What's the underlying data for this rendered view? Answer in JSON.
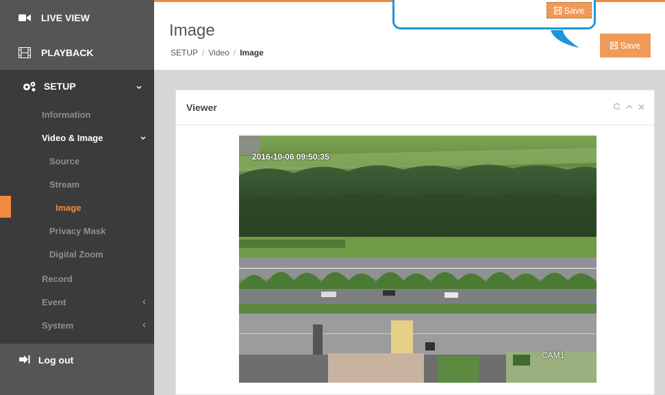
{
  "sidebar": {
    "live_view": "LIVE VIEW",
    "playback": "PLAYBACK",
    "setup": "SETUP",
    "items": [
      {
        "label": "Information"
      },
      {
        "label": "Video & Image"
      },
      {
        "label": "Source"
      },
      {
        "label": "Stream"
      },
      {
        "label": "Image"
      },
      {
        "label": "Privacy Mask"
      },
      {
        "label": "Digital Zoom"
      },
      {
        "label": "Record"
      },
      {
        "label": "Event"
      },
      {
        "label": "System"
      }
    ],
    "logout": "Log out"
  },
  "header": {
    "title": "Image",
    "breadcrumb": [
      "SETUP",
      "Video",
      "Image"
    ],
    "save_label": "Save"
  },
  "callout": {
    "save_label": "Save"
  },
  "panel": {
    "title": "Viewer",
    "timestamp": "2016-10-06  09:50:35",
    "camera": "CAM1"
  },
  "colors": {
    "accent": "#ef8a3e",
    "callout_border": "#1e95d8",
    "sidebar_dark": "#2d2d2d"
  }
}
